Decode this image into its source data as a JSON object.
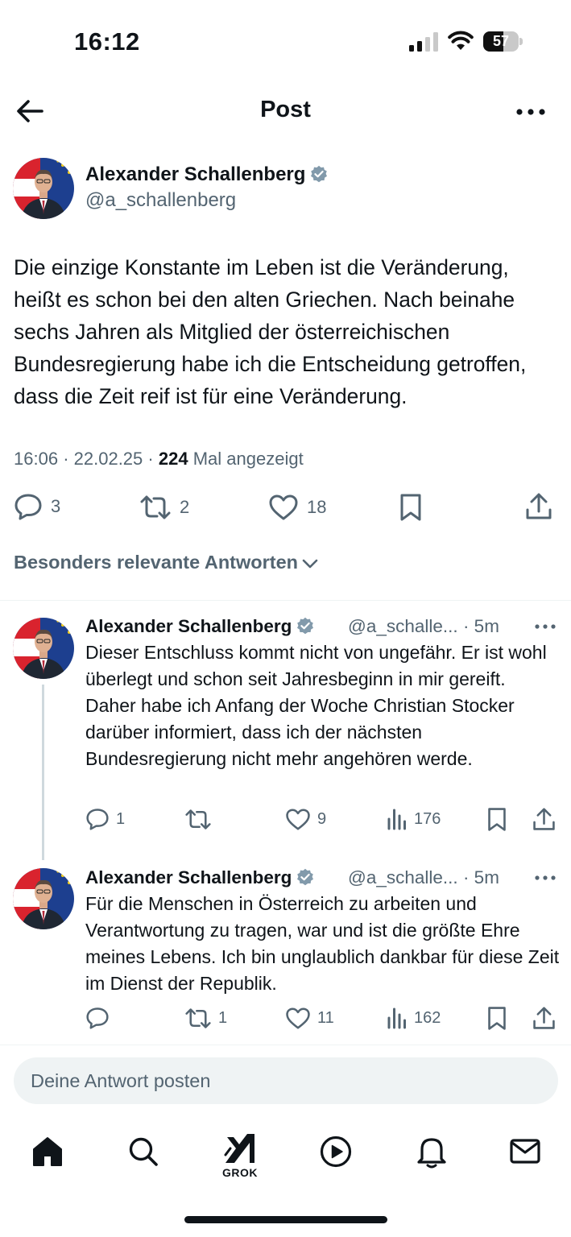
{
  "status_bar": {
    "time": "16:12",
    "battery": "57",
    "battery_level": 0.57,
    "icons": [
      "signal-icon",
      "wifi-icon",
      "battery-icon"
    ]
  },
  "header": {
    "title": "Post",
    "icons": [
      "back-arrow-icon",
      "more-options-icon"
    ]
  },
  "post": {
    "author_name": "Alexander Schallenberg",
    "author_handle": "@a_schallenberg",
    "text": "Die einzige Konstante im Leben ist die Veränderung, heißt es schon bei den alten Griechen. Nach beinahe sechs Jahren als Mitglied der österreichischen Bundesregierung habe ich die Entscheidung getroffen, dass die Zeit reif ist für eine Veränderung.",
    "time": "16:06",
    "date": "22.02.25",
    "views": "224",
    "views_label": "Mal angezeigt",
    "replies": "3",
    "reposts": "2",
    "likes": "18"
  },
  "replies_filter": {
    "label": "Besonders relevante Antworten",
    "icon": "chevron-down-icon"
  },
  "replies": [
    {
      "author_name": "Alexander Schallenberg",
      "author_handle": "@a_schalle...",
      "age": "· 5m",
      "text": "Dieser Entschluss kommt nicht von ungefähr. Er ist wohl überlegt und schon seit Jahresbeginn in mir gereift. Daher habe ich Anfang der Woche Christian Stocker darüber informiert, dass ich der nächsten Bundesregierung nicht mehr angehören werde.",
      "replies": "1",
      "reposts": "",
      "likes": "9",
      "views": "176"
    },
    {
      "author_name": "Alexander Schallenberg",
      "author_handle": "@a_schalle...",
      "age": "· 5m",
      "text": "Für die Menschen in Österreich zu arbeiten und Verantwortung zu tragen, war und ist die größte Ehre meines Lebens. Ich bin unglaublich dankbar für diese Zeit im Dienst der Republik.",
      "replies": "",
      "reposts": "1",
      "likes": "11",
      "views": "162"
    }
  ],
  "compose": {
    "placeholder": "Deine Antwort posten"
  },
  "tab_bar": {
    "grok_label": "GROK",
    "icons": [
      "home-icon",
      "search-icon",
      "grok-icon",
      "video-icon",
      "notifications-icon",
      "messages-icon"
    ]
  },
  "colors": {
    "text": "#0f1419",
    "secondary": "#536471",
    "verified": "#829aab",
    "divider": "#eff3f4",
    "input_bg": "#eff3f4"
  }
}
